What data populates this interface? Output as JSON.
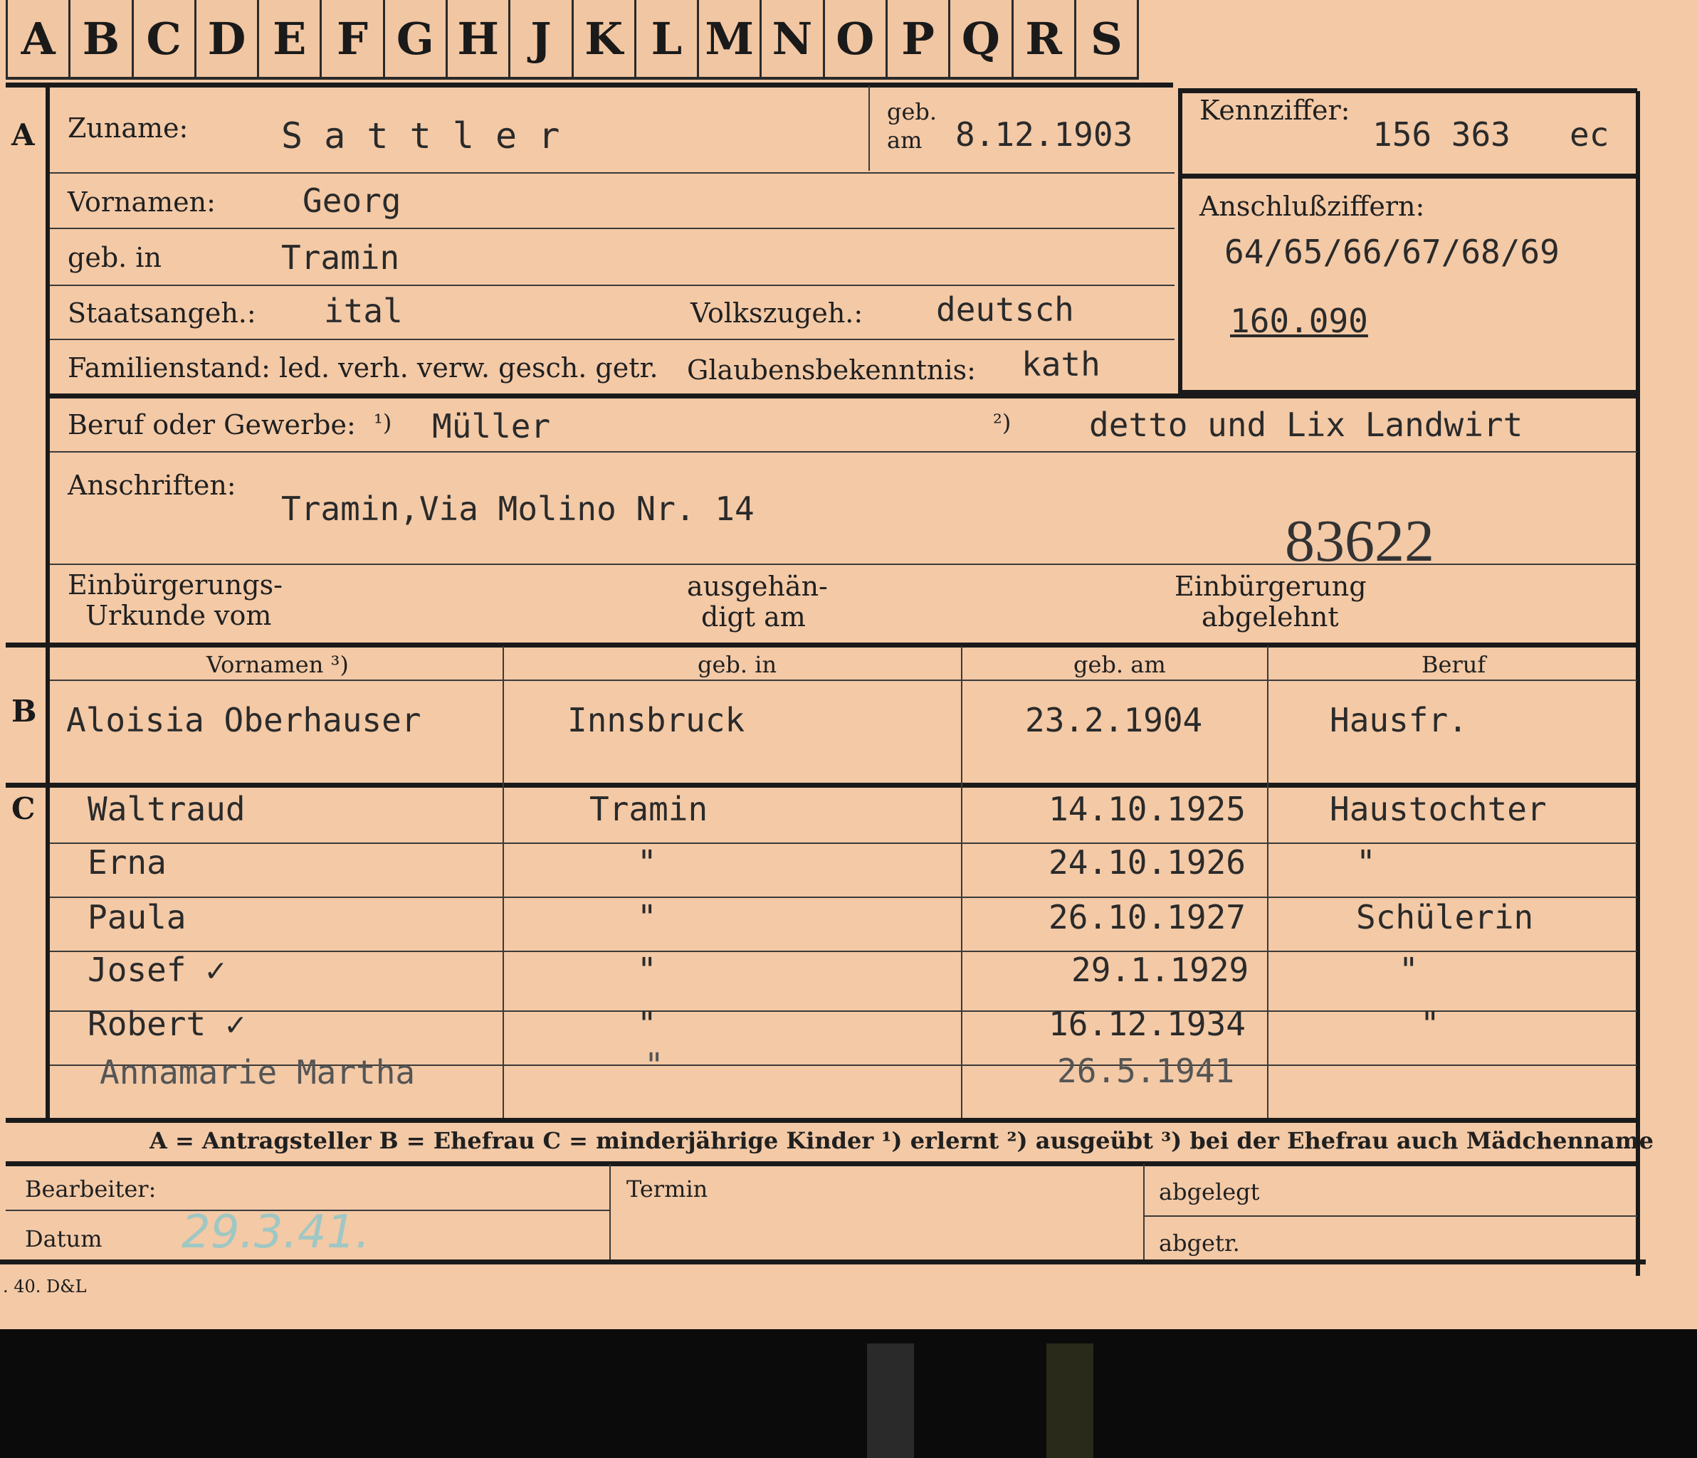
{
  "tabs": [
    "A",
    "B",
    "C",
    "D",
    "E",
    "F",
    "G",
    "H",
    "J",
    "K",
    "L",
    "M",
    "N",
    "O",
    "P",
    "Q",
    "R",
    "S"
  ],
  "sections": {
    "a": "A",
    "b": "B",
    "c": "C"
  },
  "applicant": {
    "surname_label": "Zuname:",
    "surname": "S a t t l e r",
    "born_on_label_1": "geb.",
    "born_on_label_2": "am",
    "born_on": "8.12.1903",
    "given_names_label": "Vornamen:",
    "given_names": "Georg",
    "birthplace_label": "geb. in",
    "birthplace": "Tramin",
    "citizenship_label": "Staatsangeh.:",
    "citizenship": "ital",
    "ethnicity_label": "Volkszugeh.:",
    "ethnicity": "deutsch",
    "marital_label": "Familienstand: led. verh. verw. gesch. getr.",
    "religion_label": "Glaubensbekenntnis:",
    "religion": "kath",
    "profession_label": "Beruf oder Gewerbe:",
    "note1": "¹)",
    "profession_learned": "Müller",
    "note2": "²)",
    "profession_practiced": "detto und Lix Landwirt",
    "addresses_label": "Anschriften:",
    "address": "Tramin,Via Molino Nr. 14",
    "stamp_number": "83622",
    "naturalization_doc_label_1": "Einbürgerungs-",
    "naturalization_doc_label_2": "Urkunde vom",
    "handed_label_1": "ausgehän-",
    "handed_label_2": "digt am",
    "refused_label_1": "Einbürgerung",
    "refused_label_2": "abgelehnt"
  },
  "reference": {
    "kennziffer_label": "Kennziffer:",
    "kennziffer": "156 363",
    "kennziffer_suffix": "ec",
    "anschluss_label": "Anschlußziffern:",
    "anschluss": "64/65/66/67/68/69",
    "anschluss_2": "160.090"
  },
  "spouse": {
    "headers": [
      "Vornamen ³)",
      "geb. in",
      "geb. am",
      "Beruf"
    ],
    "row": [
      "Aloisia Oberhauser",
      "Innsbruck",
      "23.2.1904",
      "Hausfr."
    ]
  },
  "children": [
    [
      "Waltraud",
      "Tramin",
      "14.10.1925",
      "Haustochter"
    ],
    [
      "Erna",
      "\"",
      "24.10.1926",
      "\""
    ],
    [
      "Paula",
      "\"",
      "26.10.1927",
      "Schülerin"
    ],
    [
      "Josef ✓",
      "\"",
      "29.1.1929",
      "\""
    ],
    [
      "Robert ✓",
      "\"",
      "16.12.1934",
      "\""
    ],
    [
      "Annamarie Martha",
      "\"",
      "26.5.1941",
      ""
    ]
  ],
  "legend": "A = Antragsteller   B = Ehefrau   C = minderjährige Kinder   ¹) erlernt   ²) ausgeübt   ³) bei der Ehefrau auch Mädchenname",
  "footer": {
    "bearbeiter_label": "Bearbeiter:",
    "datum_label": "Datum",
    "datum": "29.3.41.",
    "termin_label": "Termin",
    "abgelegt_label": "abgelegt",
    "abgetr_label": "abgetr.",
    "print_code": ". 40. D&L"
  }
}
